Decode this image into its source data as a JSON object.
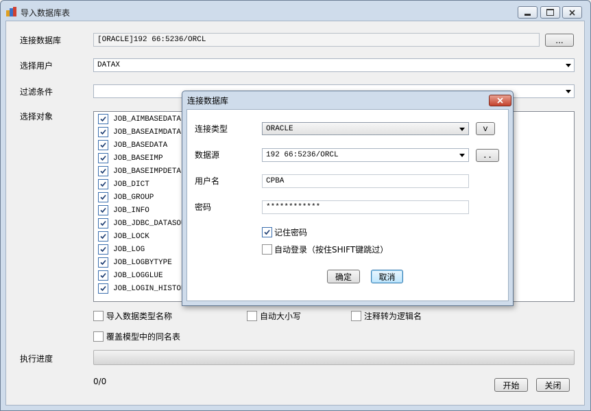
{
  "window": {
    "title": "导入数据库表",
    "minimize_icon": "minimize-icon",
    "maximize_icon": "maximize-icon",
    "close_icon": "close-icon"
  },
  "form": {
    "connection_label": "连接数据库",
    "connection_value": "[ORACLE]192        66:5236/ORCL",
    "browse_button": "...",
    "user_label": "选择用户",
    "user_value": "DATAX",
    "filter_label": "过滤条件",
    "filter_value": "",
    "objects_label": "选择对象"
  },
  "objects": [
    {
      "name": "JOB_AIMBASEDATA",
      "checked": true
    },
    {
      "name": "JOB_BASEAIMDATA",
      "checked": true
    },
    {
      "name": "JOB_BASEDATA",
      "checked": true
    },
    {
      "name": "JOB_BASEIMP",
      "checked": true
    },
    {
      "name": "JOB_BASEIMPDETAIL",
      "checked": true
    },
    {
      "name": "JOB_DICT",
      "checked": true
    },
    {
      "name": "JOB_GROUP",
      "checked": true
    },
    {
      "name": "JOB_INFO",
      "checked": true
    },
    {
      "name": "JOB_JDBC_DATASOURCE",
      "checked": true
    },
    {
      "name": "JOB_LOCK",
      "checked": true
    },
    {
      "name": "JOB_LOG",
      "checked": true
    },
    {
      "name": "JOB_LOGBYTYPE",
      "checked": true
    },
    {
      "name": "JOB_LOGGLUE",
      "checked": true
    },
    {
      "name": "JOB_LOGIN_HISTORY",
      "checked": true
    }
  ],
  "options": {
    "import_type_name": {
      "label": "导入数据类型名称",
      "checked": false
    },
    "auto_case": {
      "label": "自动大小写",
      "checked": false
    },
    "comment_to_logical": {
      "label": "注释转为逻辑名",
      "checked": false
    },
    "overwrite_same_name": {
      "label": "覆盖模型中的同名表",
      "checked": false
    }
  },
  "progress": {
    "label": "执行进度",
    "fraction": 0,
    "count_text": "0/0"
  },
  "buttons": {
    "start": "开始",
    "close": "关闭"
  },
  "dialog": {
    "title": "连接数据库",
    "type_label": "连接类型",
    "type_value": "ORACLE",
    "type_button": "v",
    "source_label": "数据源",
    "source_value": "192        66:5236/ORCL",
    "source_button": "..",
    "username_label": "用户名",
    "username_value": "CPBA",
    "password_label": "密码",
    "password_value": "************",
    "remember_label": "记住密码",
    "remember_checked": true,
    "autologin_label": "自动登录（按住SHIFT键跳过）",
    "autologin_checked": false,
    "ok_button": "确定",
    "cancel_button": "取消"
  }
}
